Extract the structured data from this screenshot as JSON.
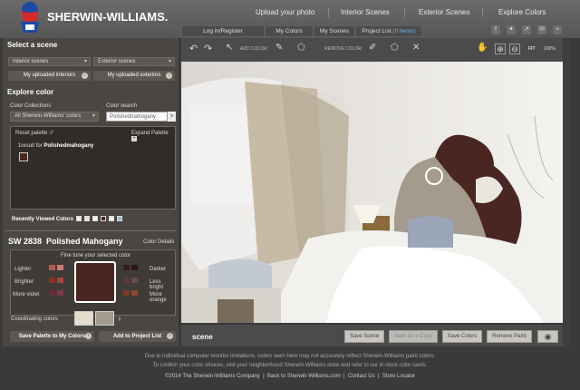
{
  "brand": {
    "name": "SHERWIN-WILLIAMS."
  },
  "topnav": [
    "Upload your photo",
    "Interior Scenes",
    "Exterior Scenes",
    "Explore Colors"
  ],
  "subtabs": {
    "login": "Log in/Register",
    "my_colors": "My Colors",
    "my_scenes": "My Scenes",
    "project_list": "Project List",
    "items": "(0 items)"
  },
  "social": [
    "f",
    "t",
    "share",
    "@",
    "+"
  ],
  "left": {
    "select_scene": "Select a scene",
    "interior_dd": "Interior scenes",
    "exterior_dd": "Exterior scenes",
    "my_interiors": "My uploaded interiors",
    "my_exteriors": "My uploaded exteriors",
    "explore_color": "Explore color",
    "collections_label": "Color Collections",
    "collections_value": "All Sherwin-Williams' colors",
    "search_label": "Color search",
    "search_value": "Polishedmahogany",
    "search_go": ">",
    "reset_palette": "Reset palette",
    "expand_palette": "Expand Palette",
    "result_count": "1result for",
    "result_term": "Polishedmahogany",
    "recent_label": "Recently Viewed Colors",
    "color_code": "SW 2838",
    "color_name": "Polished Mahogany",
    "color_details": "Color Details",
    "fine_tune": "Fine tune your selected color",
    "lighter": "Lighter",
    "brighter": "Brighter",
    "more_violet": "More violet",
    "darker": "Darker",
    "less_bright": "Less bright",
    "more_orange": "More orange",
    "coordinating": "Coordinating colors",
    "save_palette": "Save Palette to My Colors",
    "add_project": "Add to Project List"
  },
  "toolbar": {
    "add_color": "ADD COLOR:",
    "remove_color": "REMOVE COLOR:",
    "fit": "FIT",
    "zoom": "100%"
  },
  "bottom": {
    "scene_label": "scene",
    "save_scene": "Save Scene",
    "save_copy": "Save as a Copy",
    "save_colors": "Save Colors",
    "remove_paint": "Remove Paint"
  },
  "footer": {
    "line1": "Due to individual computer monitor limitations, colors seen here may not accurately reflect Sherwin-Williams paint colors.",
    "line2": "To confirm your color choices, visit your neighborhood Sherwin-Williams store and refer to our in-store color cards.",
    "copyright": "©2014 The Sherwin-Williams Company",
    "link1": "Back to Sherwin-Williams.com",
    "link2": "Contact Us",
    "link3": "Store Locator",
    "sep": "|"
  },
  "colors": {
    "selected": "#4a2622",
    "panel": "#4a4743",
    "recent": [
      "#efe9d8",
      "#e6e0cd",
      "#f3efe2",
      "#4a2622",
      "#f2efe6",
      "#9fb9c4"
    ],
    "coord": [
      "#e6dccd",
      "#a39b90"
    ],
    "lighter": [
      "#b55a55",
      "#c97a74"
    ],
    "brighter": [
      "#8e2f2a",
      "#a8433d"
    ],
    "violet": [
      "#6b2c3a",
      "#7e3948"
    ],
    "darker": [
      "#3a1d1a",
      "#2e1714"
    ],
    "lessbright": [
      "#5a3a35",
      "#6e4a44"
    ],
    "orange": [
      "#7a3a22",
      "#8e4a2c"
    ]
  }
}
